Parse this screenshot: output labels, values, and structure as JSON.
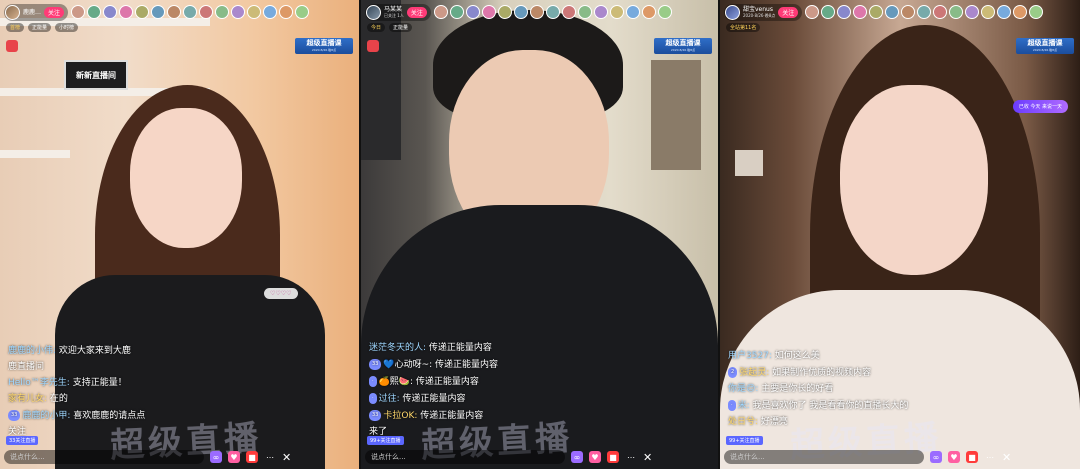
{
  "panels": [
    {
      "host": {
        "name": "鹿鹿…",
        "sub": ""
      },
      "follow_label": "关注",
      "viewer_count": "",
      "badges": [
        "首榜",
        "正能量",
        "小时榜"
      ],
      "brand": {
        "line1": "超级直播课",
        "line2": "2020·8/26·晚8点"
      },
      "sign_text": "新新直播间",
      "sticker_text": "♡♡♡♡",
      "chat": [
        {
          "user": "鹿鹿的小伟:",
          "text": " 欢迎大家来到大鹿",
          "lv": ""
        },
        {
          "user": "",
          "text": "鹿直播间",
          "lv": ""
        },
        {
          "user": "Hello™李先生:",
          "text": " 支持正能量！",
          "lv": ""
        },
        {
          "user": "家有儿女:",
          "text": " 在的",
          "lv": ""
        },
        {
          "user": "",
          "text": "",
          "lv": ""
        },
        {
          "user": "鹿鹿的小甲:",
          "text": " 喜欢鹿鹿的请点点",
          "lv": "33"
        },
        {
          "user": "",
          "text": "关注",
          "lv": ""
        }
      ],
      "followers_tag": "33关注直播",
      "say_placeholder": "说点什么...",
      "watermark": "超级直播"
    },
    {
      "host": {
        "name": "马某某",
        "sub": "已关注 1人"
      },
      "follow_label": "关注",
      "viewer_count": "",
      "badges": [
        "今日",
        "正能量"
      ],
      "brand": {
        "line1": "超级直播课",
        "line2": "2020·8/26·晚8点"
      },
      "chat": [
        {
          "user": "迷茫冬天的人:",
          "text": " 传递正能量内容",
          "lv": ""
        },
        {
          "user": "",
          "text": "💙心动呀~: 传递正能量内容",
          "lv": "33"
        },
        {
          "user": "",
          "text": "🍊熙🍉: 传递正能量内容",
          "lv": ""
        },
        {
          "user": "过往:",
          "text": " 传递正能量内容",
          "lv": ""
        },
        {
          "user": "",
          "text": "",
          "lv": ""
        },
        {
          "user": "卡拉OK:",
          "text": " 传递正能量内容",
          "lv": "33"
        },
        {
          "user": "",
          "text": "来了",
          "lv": ""
        }
      ],
      "followers_tag": "99+关注直播",
      "say_placeholder": "说点什么...",
      "watermark": "超级直播"
    },
    {
      "host": {
        "name": "甜宝venus",
        "sub": "2020·8/26·晚8点"
      },
      "follow_label": "关注",
      "viewer_count": "",
      "badges": [
        "全站第11名"
      ],
      "brand": {
        "line1": "超级直播课",
        "line2": "2020·8/26·晚8点"
      },
      "pink_pill": "已收 今天 来说一天",
      "chat": [
        {
          "user": "用户3527:",
          "text": " 如何这么美",
          "lv": ""
        },
        {
          "user": "张起灵:",
          "text": " 如果制作优质的视频内容",
          "lv": "2"
        },
        {
          "user": "你是😊:",
          "text": " 主要是你长的好看",
          "lv": ""
        },
        {
          "user": "米:",
          "text": " 我是喜欢你了 我是看看你的直播长大的",
          "lv": ""
        },
        {
          "user": "处日兮:",
          "text": " 好漂亮",
          "lv": ""
        }
      ],
      "followers_tag": "99+关注直播",
      "say_placeholder": "说点什么...",
      "watermark": "超级直播"
    }
  ],
  "viewer_colors": [
    "#c98",
    "#6a8",
    "#88c",
    "#d7a",
    "#aa6",
    "#69b",
    "#b86",
    "#7aa",
    "#c77",
    "#8b8",
    "#a8c",
    "#cb7",
    "#7ad",
    "#d96",
    "#9c8"
  ]
}
